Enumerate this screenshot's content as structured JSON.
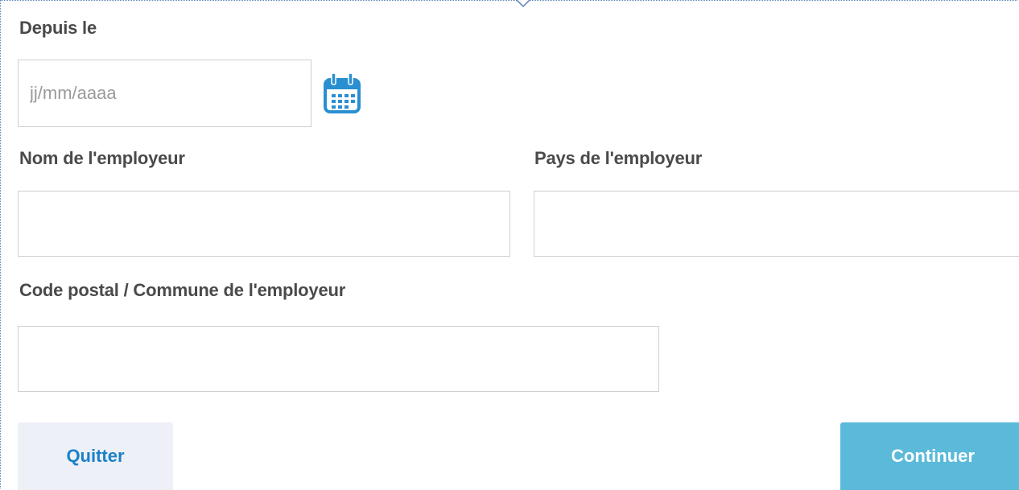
{
  "form": {
    "since": {
      "label": "Depuis le",
      "value": "",
      "placeholder": "jj/mm/aaaa",
      "icon": "calendar-icon"
    },
    "employer_name": {
      "label": "Nom de l'employeur",
      "value": ""
    },
    "employer_country": {
      "label": "Pays de l'employeur",
      "value": ""
    },
    "employer_postcode": {
      "label": "Code postal / Commune de l'employeur",
      "value": ""
    }
  },
  "actions": {
    "quit_label": "Quitter",
    "continue_label": "Continuer"
  },
  "colors": {
    "accent": "#1b81c8",
    "calendar_icon": "#2a8fd1",
    "continue_bg": "#5bbad9",
    "quit_bg": "#eef0f7",
    "label_text": "#4a4a4a",
    "field_border": "#cfcfcf"
  }
}
